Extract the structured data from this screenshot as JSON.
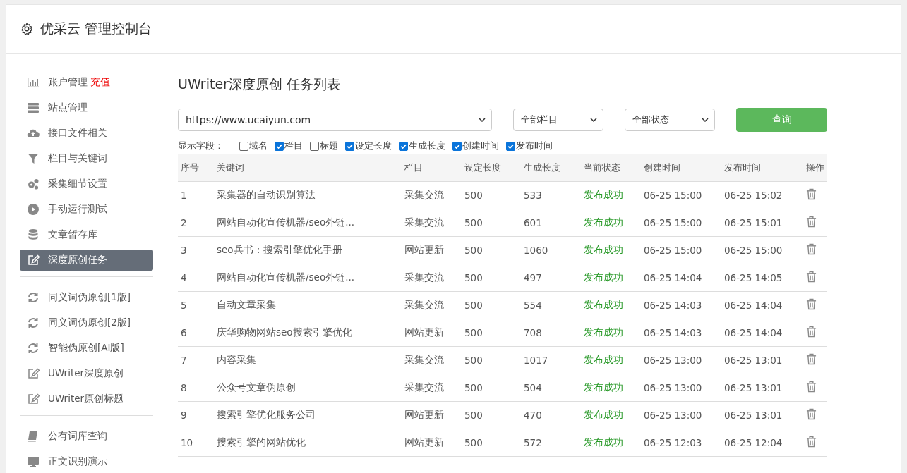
{
  "header": {
    "title": "优采云 管理控制台"
  },
  "sidebar": {
    "groups": [
      {
        "items": [
          {
            "label": "账户管理",
            "badge": "充值",
            "selected": false
          },
          {
            "label": "站点管理",
            "selected": false
          },
          {
            "label": "接口文件相关",
            "selected": false
          },
          {
            "label": "栏目与关键词",
            "selected": false
          },
          {
            "label": "采集细节设置",
            "selected": false
          },
          {
            "label": "手动运行测试",
            "selected": false
          },
          {
            "label": "文章暂存库",
            "selected": false
          },
          {
            "label": "深度原创任务",
            "selected": true
          }
        ]
      },
      {
        "items": [
          {
            "label": "同义词伪原创[1版]",
            "selected": false
          },
          {
            "label": "同义词伪原创[2版]",
            "selected": false
          },
          {
            "label": "智能伪原创[AI版]",
            "selected": false
          },
          {
            "label": "UWriter深度原创",
            "selected": false
          },
          {
            "label": "UWriter原创标题",
            "selected": false
          }
        ]
      },
      {
        "items": [
          {
            "label": "公有词库查询",
            "selected": false
          },
          {
            "label": "正文识别演示",
            "selected": false
          }
        ]
      }
    ]
  },
  "main": {
    "title": "UWriter深度原创 任务列表",
    "filters": {
      "site": "https://www.ucaiyun.com",
      "column": "全部栏目",
      "status": "全部状态",
      "button": "查询"
    },
    "fields_label": "显示字段：",
    "fields": [
      {
        "label": "域名",
        "checked": false
      },
      {
        "label": "栏目",
        "checked": true
      },
      {
        "label": "标题",
        "checked": false
      },
      {
        "label": "设定长度",
        "checked": true
      },
      {
        "label": "生成长度",
        "checked": true
      },
      {
        "label": "创建时间",
        "checked": true
      },
      {
        "label": "发布时间",
        "checked": true
      }
    ],
    "table": {
      "columns": [
        "序号",
        "关键词",
        "栏目",
        "设定长度",
        "生成长度",
        "当前状态",
        "创建时间",
        "发布时间",
        "操作"
      ],
      "rows": [
        {
          "no": "1",
          "keyword": "采集器的自动识别算法",
          "column": "采集交流",
          "set_len": "500",
          "gen_len": "533",
          "status": "发布成功",
          "created": "06-25 15:00",
          "published": "06-25 15:02"
        },
        {
          "no": "2",
          "keyword": "网站自动化宣传机器/seo外链...",
          "column": "采集交流",
          "set_len": "500",
          "gen_len": "601",
          "status": "发布成功",
          "created": "06-25 15:00",
          "published": "06-25 15:01"
        },
        {
          "no": "3",
          "keyword": "seo兵书：搜索引擎优化手册",
          "column": "网站更新",
          "set_len": "500",
          "gen_len": "1060",
          "status": "发布成功",
          "created": "06-25 15:00",
          "published": "06-25 15:00"
        },
        {
          "no": "4",
          "keyword": "网站自动化宣传机器/seo外链...",
          "column": "采集交流",
          "set_len": "500",
          "gen_len": "497",
          "status": "发布成功",
          "created": "06-25 14:04",
          "published": "06-25 14:05"
        },
        {
          "no": "5",
          "keyword": "自动文章采集",
          "column": "采集交流",
          "set_len": "500",
          "gen_len": "554",
          "status": "发布成功",
          "created": "06-25 14:03",
          "published": "06-25 14:04"
        },
        {
          "no": "6",
          "keyword": "庆华购物网站seo搜索引擎优化",
          "column": "网站更新",
          "set_len": "500",
          "gen_len": "708",
          "status": "发布成功",
          "created": "06-25 14:03",
          "published": "06-25 14:04"
        },
        {
          "no": "7",
          "keyword": "内容采集",
          "column": "采集交流",
          "set_len": "500",
          "gen_len": "1017",
          "status": "发布成功",
          "created": "06-25 13:00",
          "published": "06-25 13:01"
        },
        {
          "no": "8",
          "keyword": "公众号文章伪原创",
          "column": "采集交流",
          "set_len": "500",
          "gen_len": "504",
          "status": "发布成功",
          "created": "06-25 13:00",
          "published": "06-25 13:01"
        },
        {
          "no": "9",
          "keyword": "搜索引擎优化服务公司",
          "column": "网站更新",
          "set_len": "500",
          "gen_len": "470",
          "status": "发布成功",
          "created": "06-25 13:00",
          "published": "06-25 13:01"
        },
        {
          "no": "10",
          "keyword": "搜索引擎的网站优化",
          "column": "网站更新",
          "set_len": "500",
          "gen_len": "572",
          "status": "发布成功",
          "created": "06-25 12:03",
          "published": "06-25 12:04"
        }
      ]
    }
  }
}
